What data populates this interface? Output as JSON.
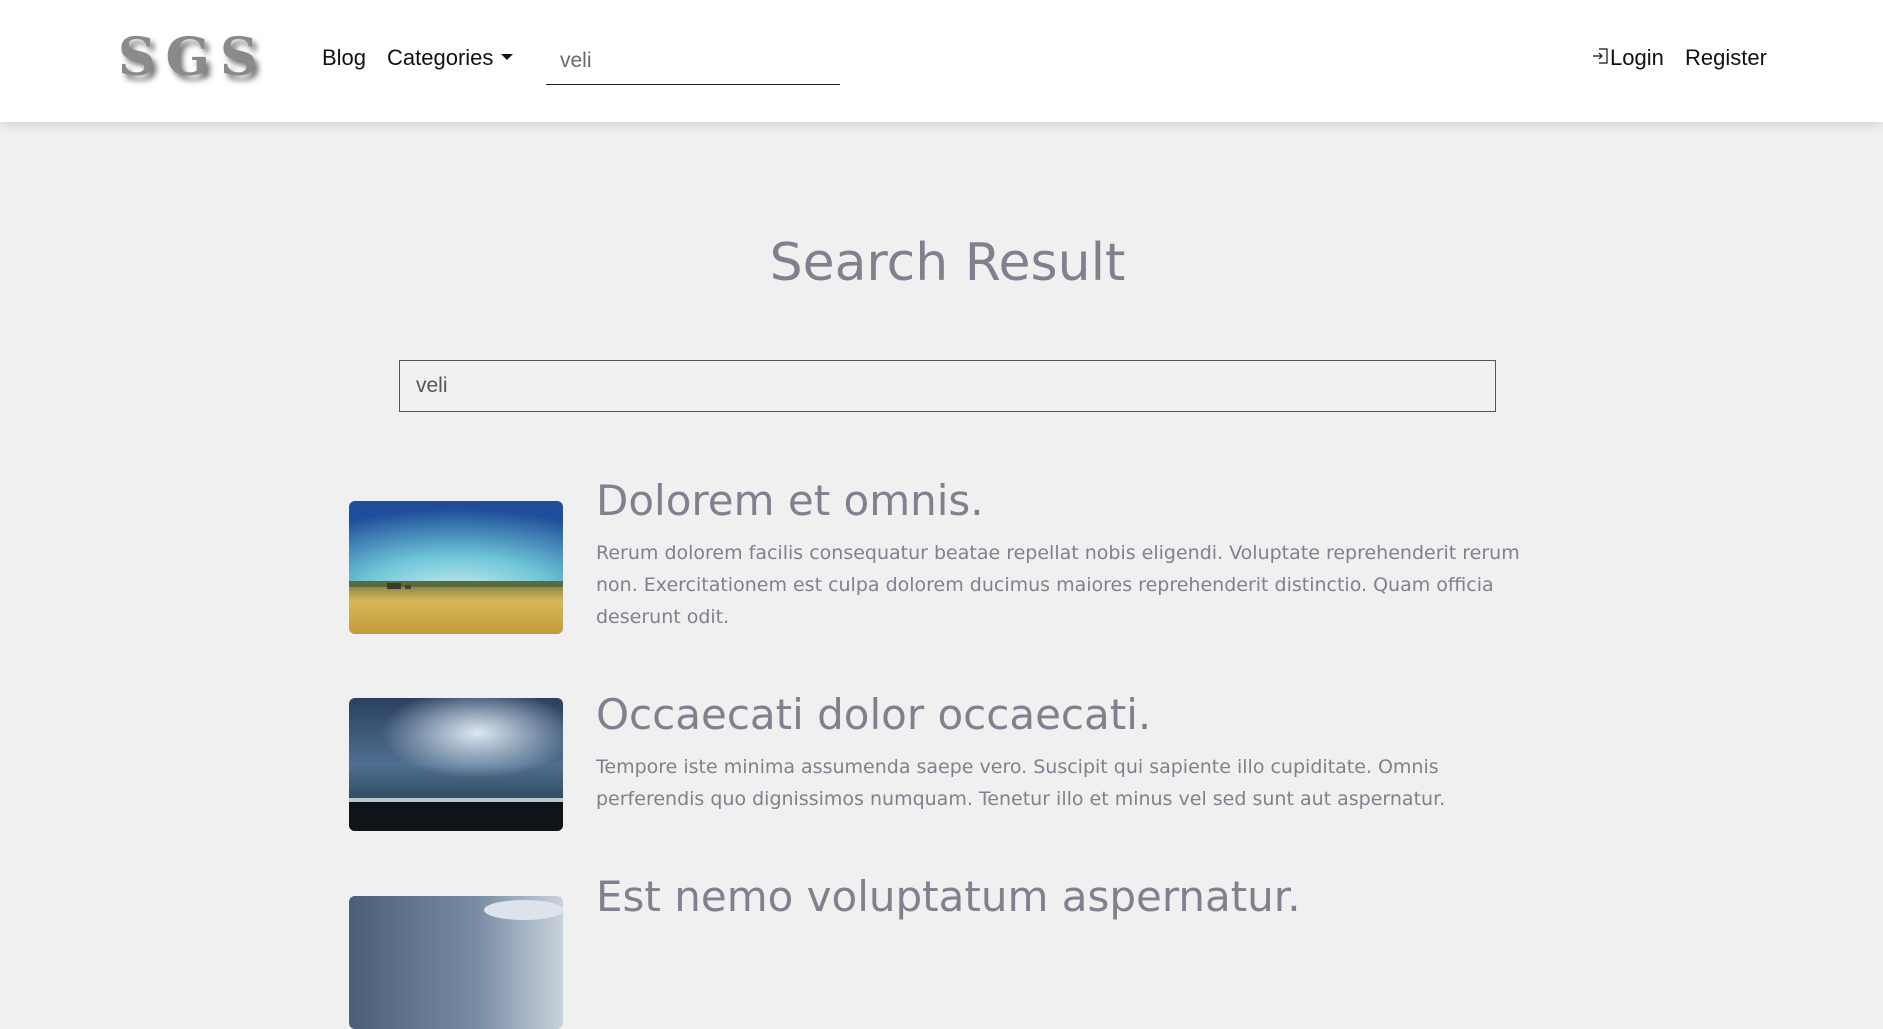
{
  "navbar": {
    "logo": "SGS",
    "blog_label": "Blog",
    "categories_label": "Categories",
    "search_value": "veli",
    "login_label": "Login",
    "register_label": "Register"
  },
  "page": {
    "title": "Search Result",
    "search_value": "veli"
  },
  "results": [
    {
      "title": "Dolorem et omnis.",
      "body": "Rerum dolorem facilis consequatur beatae repellat nobis eligendi. Voluptate reprehenderit rerum non. Exercitationem est culpa dolorem ducimus maiores reprehenderit distinctio. Quam officia deserunt odit.",
      "image": "wheat-field-landscape"
    },
    {
      "title": "Occaecati dolor occaecati.",
      "body": "Tempore iste minima assumenda saepe vero. Suscipit qui sapiente illo cupiditate. Omnis perferendis quo dignissimos numquam. Tenetur illo et minus vel sed sunt aut aspernatur.",
      "image": "stormy-sea-clouds"
    },
    {
      "title": "Est nemo voluptatum aspernatur.",
      "body": "",
      "image": "cloudy-sky-landscape"
    }
  ]
}
